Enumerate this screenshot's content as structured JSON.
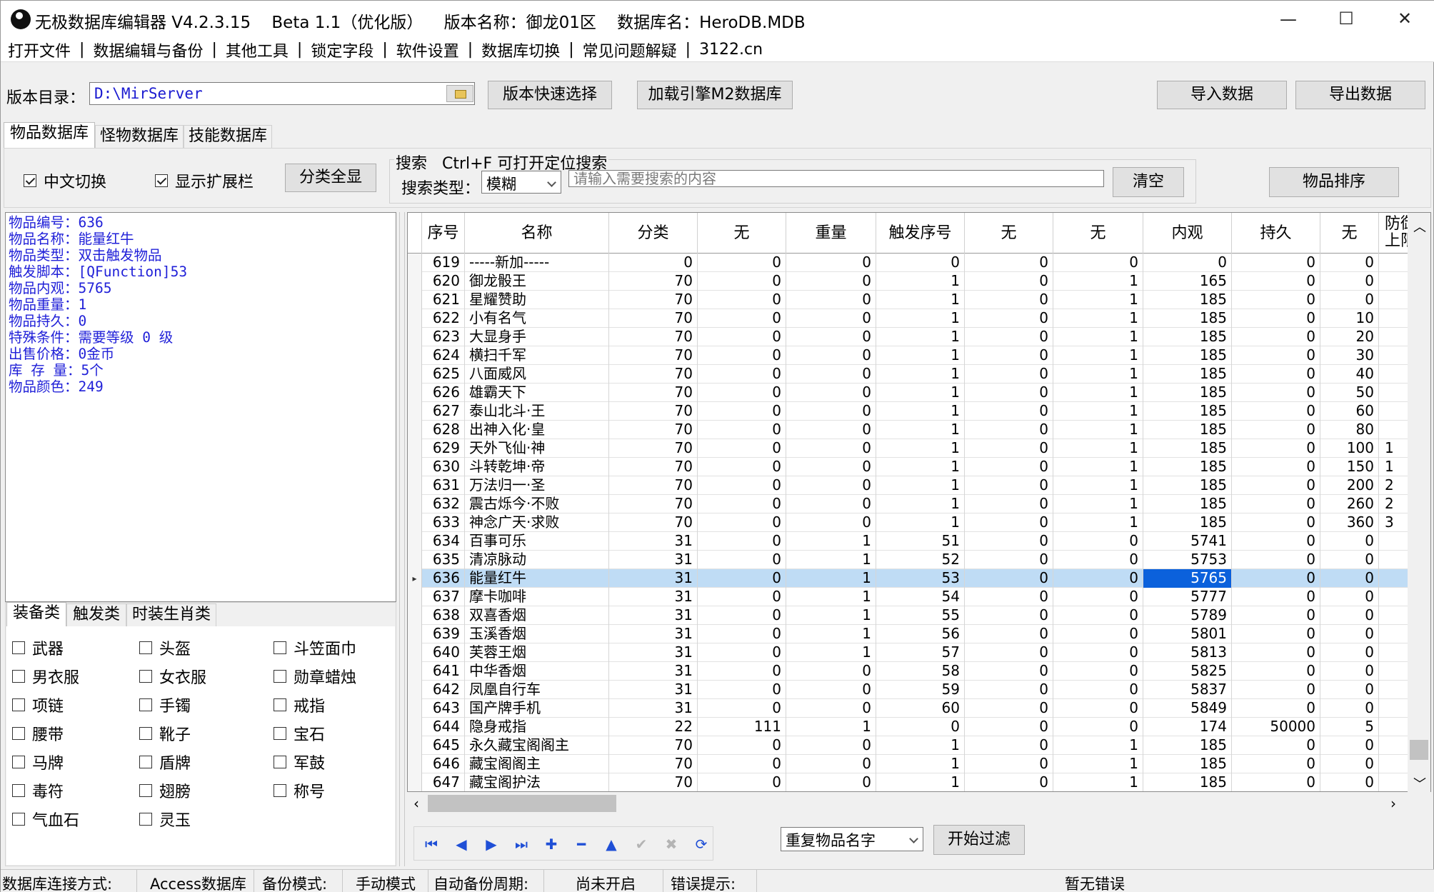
{
  "window": {
    "title": "无极数据库编辑器 V4.2.3.15    Beta 1.1（优化版）    版本名称：御龙01区    数据库名：HeroDB.MDB",
    "minimize": "—",
    "maximize": "☐",
    "close": "✕"
  },
  "menu": [
    "打开文件",
    "数据编辑与备份",
    "其他工具",
    "锁定字段",
    "软件设置",
    "数据库切换",
    "常见问题解疑",
    "3122.cn"
  ],
  "menu_separator": "|",
  "toolbar": {
    "dir_label": "版本目录：",
    "dir_value": "D:\\MirServer",
    "quick_select": "版本快速选择",
    "load_m2": "加载引擎M2数据库",
    "import": "导入数据",
    "export": "导出数据"
  },
  "tabs": [
    "物品数据库",
    "怪物数据库",
    "技能数据库"
  ],
  "filters": {
    "chinese_switch": "中文切换",
    "show_ext": "显示扩展栏",
    "show_all": "分类全显",
    "search_title": "搜索   Ctrl+F 可打开定位搜索",
    "search_type_label": "搜索类型：",
    "search_type_value": "模糊",
    "search_placeholder": "请输入需要搜索的内容",
    "clear": "清空",
    "sort": "物品排序"
  },
  "info": [
    "物品编号：636",
    "物品名称：能量红牛",
    "物品类型：双击触发物品",
    "触发脚本：[QFunction]53",
    "物品内观：5765",
    "物品重量：1",
    "物品持久：0",
    "特殊条件：需要等级 0 级",
    "出售价格：0金币",
    "库 存 量：5个",
    "物品颜色：249"
  ],
  "category_tabs": [
    "装备类",
    "触发类",
    "时装生肖类"
  ],
  "categories": [
    [
      "武器",
      "头盔",
      "斗笠面巾"
    ],
    [
      "男衣服",
      "女衣服",
      "勋章蜡烛"
    ],
    [
      "项链",
      "手镯",
      "戒指"
    ],
    [
      "腰带",
      "靴子",
      "宝石"
    ],
    [
      "马牌",
      "盾牌",
      "军鼓"
    ],
    [
      "毒符",
      "翅膀",
      "称号"
    ],
    [
      "气血石",
      "灵玉"
    ]
  ],
  "grid": {
    "columns": [
      "序号",
      "名称",
      "分类",
      "无",
      "重量",
      "触发序号",
      "无",
      "无",
      "内观",
      "持久",
      "无",
      "防御上限"
    ],
    "selected_index": 636,
    "rows": [
      [
        619,
        "-----新加-----",
        0,
        0,
        0,
        0,
        0,
        0,
        0,
        0,
        0,
        ""
      ],
      [
        620,
        "御龙骰王",
        70,
        0,
        0,
        1,
        0,
        1,
        165,
        0,
        0,
        ""
      ],
      [
        621,
        "星耀赞助",
        70,
        0,
        0,
        1,
        0,
        1,
        185,
        0,
        0,
        ""
      ],
      [
        622,
        "小有名气",
        70,
        0,
        0,
        1,
        0,
        1,
        185,
        0,
        10,
        ""
      ],
      [
        623,
        "大显身手",
        70,
        0,
        0,
        1,
        0,
        1,
        185,
        0,
        20,
        ""
      ],
      [
        624,
        "横扫千军",
        70,
        0,
        0,
        1,
        0,
        1,
        185,
        0,
        30,
        ""
      ],
      [
        625,
        "八面威风",
        70,
        0,
        0,
        1,
        0,
        1,
        185,
        0,
        40,
        ""
      ],
      [
        626,
        "雄霸天下",
        70,
        0,
        0,
        1,
        0,
        1,
        185,
        0,
        50,
        ""
      ],
      [
        627,
        "泰山北斗·王",
        70,
        0,
        0,
        1,
        0,
        1,
        185,
        0,
        60,
        ""
      ],
      [
        628,
        "出神入化·皇",
        70,
        0,
        0,
        1,
        0,
        1,
        185,
        0,
        80,
        ""
      ],
      [
        629,
        "天外飞仙·神",
        70,
        0,
        0,
        1,
        0,
        1,
        185,
        0,
        100,
        "1"
      ],
      [
        630,
        "斗转乾坤·帝",
        70,
        0,
        0,
        1,
        0,
        1,
        185,
        0,
        150,
        "1"
      ],
      [
        631,
        "万法归一·圣",
        70,
        0,
        0,
        1,
        0,
        1,
        185,
        0,
        200,
        "2"
      ],
      [
        632,
        "震古烁今·不败",
        70,
        0,
        0,
        1,
        0,
        1,
        185,
        0,
        260,
        "2"
      ],
      [
        633,
        "神念广天·求败",
        70,
        0,
        0,
        1,
        0,
        1,
        185,
        0,
        360,
        "3"
      ],
      [
        634,
        "百事可乐",
        31,
        0,
        1,
        51,
        0,
        0,
        5741,
        0,
        0,
        ""
      ],
      [
        635,
        "清凉脉动",
        31,
        0,
        1,
        52,
        0,
        0,
        5753,
        0,
        0,
        ""
      ],
      [
        636,
        "能量红牛",
        31,
        0,
        1,
        53,
        0,
        0,
        5765,
        0,
        0,
        ""
      ],
      [
        637,
        "摩卡咖啡",
        31,
        0,
        1,
        54,
        0,
        0,
        5777,
        0,
        0,
        ""
      ],
      [
        638,
        "双喜香烟",
        31,
        0,
        1,
        55,
        0,
        0,
        5789,
        0,
        0,
        ""
      ],
      [
        639,
        "玉溪香烟",
        31,
        0,
        1,
        56,
        0,
        0,
        5801,
        0,
        0,
        ""
      ],
      [
        640,
        "芙蓉王烟",
        31,
        0,
        1,
        57,
        0,
        0,
        5813,
        0,
        0,
        ""
      ],
      [
        641,
        "中华香烟",
        31,
        0,
        0,
        58,
        0,
        0,
        5825,
        0,
        0,
        ""
      ],
      [
        642,
        "凤凰自行车",
        31,
        0,
        0,
        59,
        0,
        0,
        5837,
        0,
        0,
        ""
      ],
      [
        643,
        "国产牌手机",
        31,
        0,
        0,
        60,
        0,
        0,
        5849,
        0,
        0,
        ""
      ],
      [
        644,
        "隐身戒指",
        22,
        111,
        1,
        0,
        0,
        0,
        174,
        50000,
        5,
        ""
      ],
      [
        645,
        "永久藏宝阁阁主",
        70,
        0,
        0,
        1,
        0,
        1,
        185,
        0,
        0,
        ""
      ],
      [
        646,
        "藏宝阁阁主",
        70,
        0,
        0,
        1,
        0,
        1,
        185,
        0,
        0,
        ""
      ],
      [
        647,
        "藏宝阁护法",
        70,
        0,
        0,
        1,
        0,
        1,
        185,
        0,
        0,
        ""
      ]
    ]
  },
  "nav": [
    "first-icon",
    "prev-icon",
    "next-icon",
    "last-icon",
    "add-icon",
    "delete-icon",
    "up-icon",
    "confirm-icon",
    "cancel-icon",
    "refresh-icon"
  ],
  "filter_bar": {
    "dup_select": "重复物品名字",
    "start_filter": "开始过滤"
  },
  "status": {
    "conn_label": "数据库连接方式:",
    "conn_value": "Access数据库",
    "backup_label": "备份模式:",
    "backup_value": "手动模式",
    "auto_label": "自动备份周期:",
    "auto_value": "尚未开启",
    "error_label": "错误提示:",
    "error_value": "暂无错误"
  },
  "colors": {
    "info_text": "#1f1fd8",
    "selected_row": "#bfdcf5",
    "selected_cell": "#0b61dc",
    "nav_icon": "#1f4fd6"
  }
}
